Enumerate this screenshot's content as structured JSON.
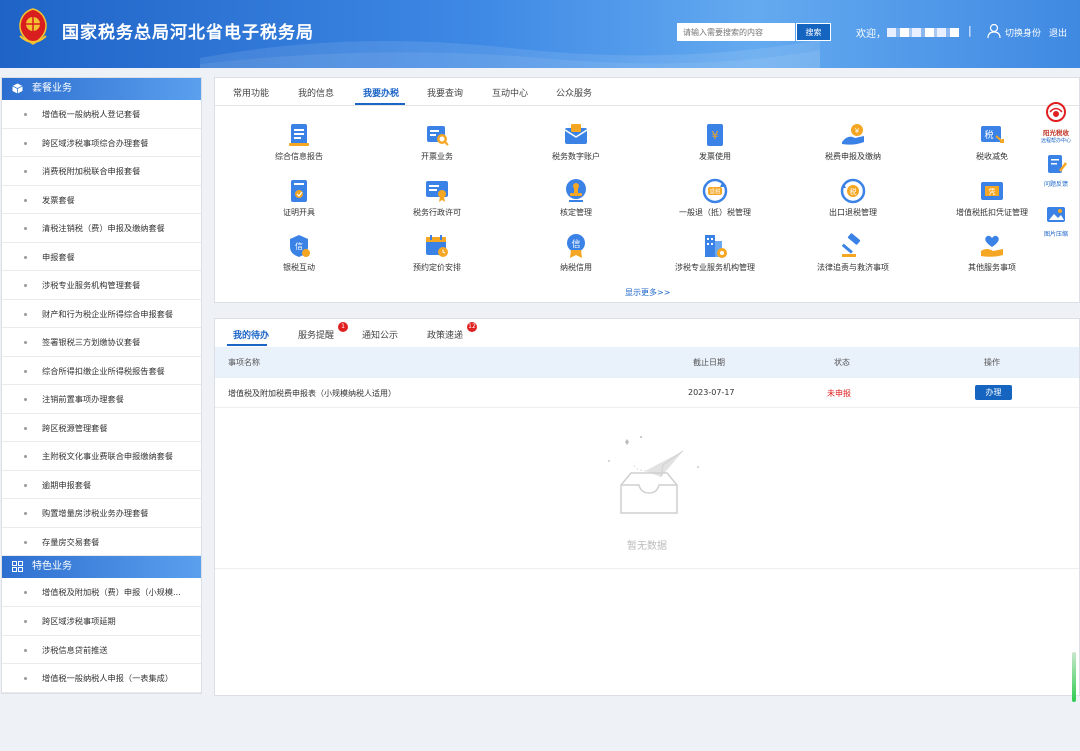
{
  "header": {
    "title": "国家税务总局河北省电子税务局",
    "search_placeholder": "请输入需要搜索的内容",
    "search_button": "搜索",
    "welcome": "欢迎，",
    "separator": "|",
    "switch_identity": "切换身份",
    "logout": "退出",
    "emblem_text": "中国税务"
  },
  "sidebar": {
    "section1_title": "套餐业务",
    "section1_items": [
      "增值税一般纳税人登记套餐",
      "跨区域涉税事项综合办理套餐",
      "消费税附加税联合申报套餐",
      "发票套餐",
      "清税注销税（费）申报及缴纳套餐",
      "申报套餐",
      "涉税专业服务机构管理套餐",
      "财产和行为税企业所得综合申报套餐",
      "签署银税三方划缴协议套餐",
      "综合所得扣缴企业所得税报告套餐",
      "注销前置事项办理套餐",
      "跨区税源管理套餐",
      "主附税文化事业费联合申报缴纳套餐",
      "逾期申报套餐",
      "购置增量房涉税业务办理套餐",
      "存量房交易套餐"
    ],
    "section2_title": "特色业务",
    "section2_items": [
      "增值税及附加税（费）申报（小规模...",
      "跨区域涉税事项延期",
      "涉税信息贷前推送",
      "增值税一般纳税人申报（一表集成）"
    ]
  },
  "func_tabs": [
    "常用功能",
    "我的信息",
    "我要办税",
    "我要查询",
    "互动中心",
    "公众服务"
  ],
  "functions": [
    {
      "label": "综合信息报告",
      "icon": "report-icon"
    },
    {
      "label": "开票业务",
      "icon": "invoice-issue-icon"
    },
    {
      "label": "税务数字账户",
      "icon": "digital-account-icon"
    },
    {
      "label": "发票使用",
      "icon": "invoice-use-icon"
    },
    {
      "label": "税费申报及缴纳",
      "icon": "tax-payment-icon"
    },
    {
      "label": "税收减免",
      "icon": "tax-relief-icon"
    },
    {
      "label": "证明开具",
      "icon": "certificate-icon"
    },
    {
      "label": "税务行政许可",
      "icon": "permit-icon"
    },
    {
      "label": "核定管理",
      "icon": "stamp-icon"
    },
    {
      "label": "一般退（抵）税管理",
      "icon": "refund-icon"
    },
    {
      "label": "出口退税管理",
      "icon": "export-refund-icon"
    },
    {
      "label": "增值税抵扣凭证管理",
      "icon": "voucher-icon"
    },
    {
      "label": "银税互动",
      "icon": "bank-tax-icon"
    },
    {
      "label": "预约定价安排",
      "icon": "calendar-icon"
    },
    {
      "label": "纳税信用",
      "icon": "credit-icon"
    },
    {
      "label": "涉税专业服务机构管理",
      "icon": "building-icon"
    },
    {
      "label": "法律追责与救济事项",
      "icon": "gavel-icon"
    },
    {
      "label": "其他服务事项",
      "icon": "heart-hand-icon"
    }
  ],
  "show_more": "显示更多>>",
  "right_tools": {
    "logo_line1": "阳光税收",
    "logo_line2": "远程帮办中心",
    "feedback": "问题反馈",
    "image_compress": "图片压缩"
  },
  "todo_tabs": [
    {
      "label": "我的待办",
      "badge": ""
    },
    {
      "label": "服务提醒",
      "badge": "1"
    },
    {
      "label": "通知公示",
      "badge": ""
    },
    {
      "label": "政策速递",
      "badge": "12"
    }
  ],
  "table": {
    "headers": [
      "事项名称",
      "截止日期",
      "状态",
      "操作"
    ],
    "rows": [
      {
        "name": "增值税及附加税费申报表（小规模纳税人适用）",
        "date": "2023-07-17",
        "status": "未申报",
        "action": "办理"
      }
    ]
  },
  "empty_text": "暂无数据",
  "colors": {
    "primary": "#1b65c7",
    "header_gradient_start": "#1f63c7",
    "status_red": "#e02020"
  }
}
